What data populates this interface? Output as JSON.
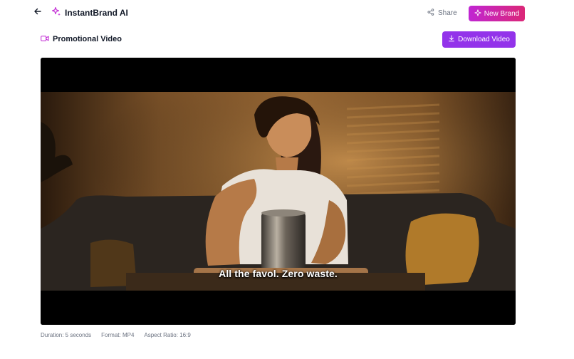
{
  "header": {
    "back_icon": "arrow-left-icon",
    "logo_icon": "sparkles-icon",
    "brand_name": "InstantBrand AI",
    "share_label": "Share",
    "share_icon": "share-icon",
    "new_brand_label": "New Brand",
    "new_brand_icon": "sparkle-icon",
    "accent_gradient": [
      "#c026d3",
      "#db2777"
    ]
  },
  "section": {
    "icon": "video-camera-icon",
    "title": "Promotional Video",
    "download_label": "Download Video",
    "download_icon": "download-icon",
    "download_color": "#9333ea"
  },
  "video": {
    "subtitle": "All the favol. Zero waste."
  },
  "meta": {
    "duration": "Duration: 5 seconds",
    "format": "Format: MP4",
    "aspect_ratio": "Aspect Ratio: 16:9"
  }
}
